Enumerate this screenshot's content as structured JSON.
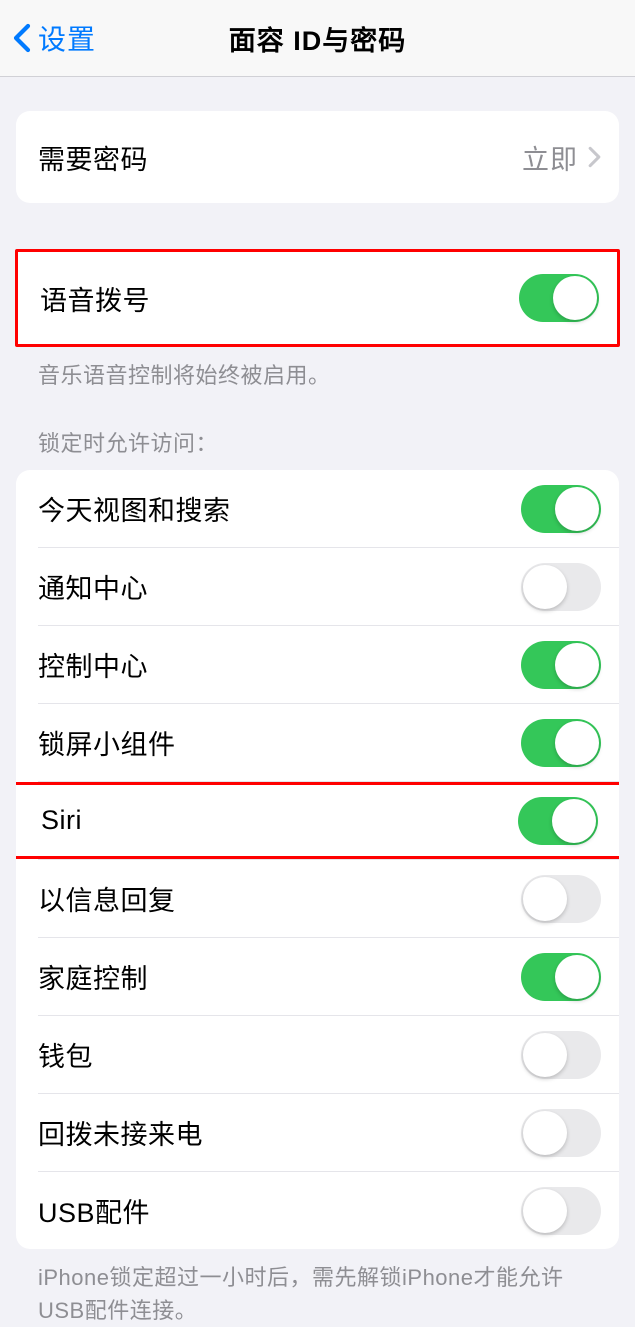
{
  "navbar": {
    "back_label": "设置",
    "title": "面容 ID与密码"
  },
  "passcode_row": {
    "label": "需要密码",
    "value": "立即"
  },
  "voice_dial": {
    "label": "语音拨号",
    "on": true,
    "footer": "音乐语音控制将始终被启用。"
  },
  "lock_access": {
    "header": "锁定时允许访问：",
    "items": [
      {
        "label": "今天视图和搜索",
        "on": true
      },
      {
        "label": "通知中心",
        "on": false
      },
      {
        "label": "控制中心",
        "on": true
      },
      {
        "label": "锁屏小组件",
        "on": true
      },
      {
        "label": "Siri",
        "on": true
      },
      {
        "label": "以信息回复",
        "on": false
      },
      {
        "label": "家庭控制",
        "on": true
      },
      {
        "label": "钱包",
        "on": false
      },
      {
        "label": "回拨未接来电",
        "on": false
      },
      {
        "label": "USB配件",
        "on": false
      }
    ],
    "footer": "iPhone锁定超过一小时后，需先解锁iPhone才能允许USB配件连接。"
  }
}
